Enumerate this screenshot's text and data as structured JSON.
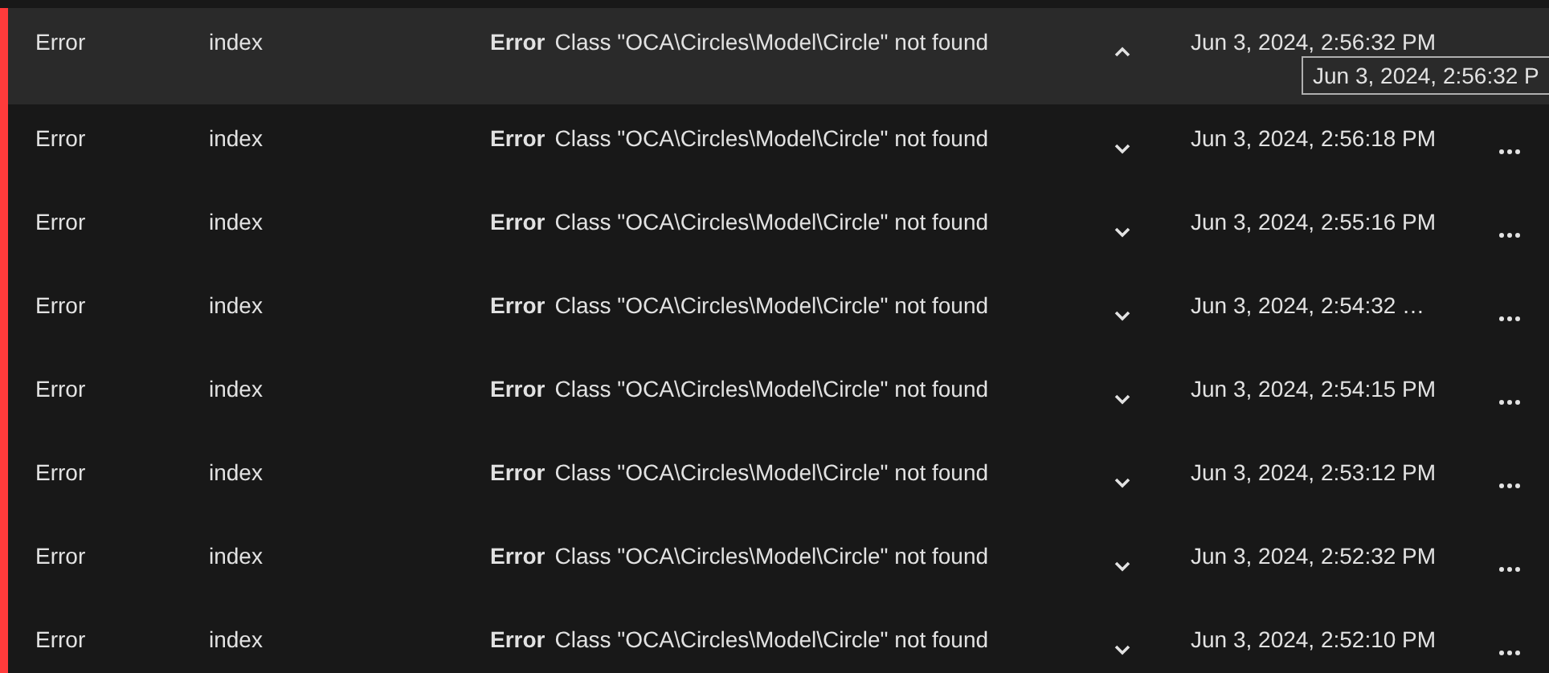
{
  "rows": [
    {
      "level": "Error",
      "source": "index",
      "label": "Error",
      "message": "Class \"OCA\\Circles\\Model\\Circle\" not found",
      "time": "Jun 3, 2024, 2:56:32 PM",
      "expanded": true,
      "selected": true,
      "tooltip": "Jun 3, 2024, 2:56:32 P"
    },
    {
      "level": "Error",
      "source": "index",
      "label": "Error",
      "message": "Class \"OCA\\Circles\\Model\\Circle\" not found",
      "time": "Jun 3, 2024, 2:56:18 PM",
      "expanded": false,
      "selected": false
    },
    {
      "level": "Error",
      "source": "index",
      "label": "Error",
      "message": "Class \"OCA\\Circles\\Model\\Circle\" not found",
      "time": "Jun 3, 2024, 2:55:16 PM",
      "expanded": false,
      "selected": false
    },
    {
      "level": "Error",
      "source": "index",
      "label": "Error",
      "message": "Class \"OCA\\Circles\\Model\\Circle\" not found",
      "time": "Jun 3, 2024, 2:54:32 …",
      "expanded": false,
      "selected": false
    },
    {
      "level": "Error",
      "source": "index",
      "label": "Error",
      "message": "Class \"OCA\\Circles\\Model\\Circle\" not found",
      "time": "Jun 3, 2024, 2:54:15 PM",
      "expanded": false,
      "selected": false
    },
    {
      "level": "Error",
      "source": "index",
      "label": "Error",
      "message": "Class \"OCA\\Circles\\Model\\Circle\" not found",
      "time": "Jun 3, 2024, 2:53:12 PM",
      "expanded": false,
      "selected": false
    },
    {
      "level": "Error",
      "source": "index",
      "label": "Error",
      "message": "Class \"OCA\\Circles\\Model\\Circle\" not found",
      "time": "Jun 3, 2024, 2:52:32 PM",
      "expanded": false,
      "selected": false
    },
    {
      "level": "Error",
      "source": "index",
      "label": "Error",
      "message": "Class \"OCA\\Circles\\Model\\Circle\" not found",
      "time": "Jun 3, 2024, 2:52:10 PM",
      "expanded": false,
      "selected": false
    }
  ]
}
